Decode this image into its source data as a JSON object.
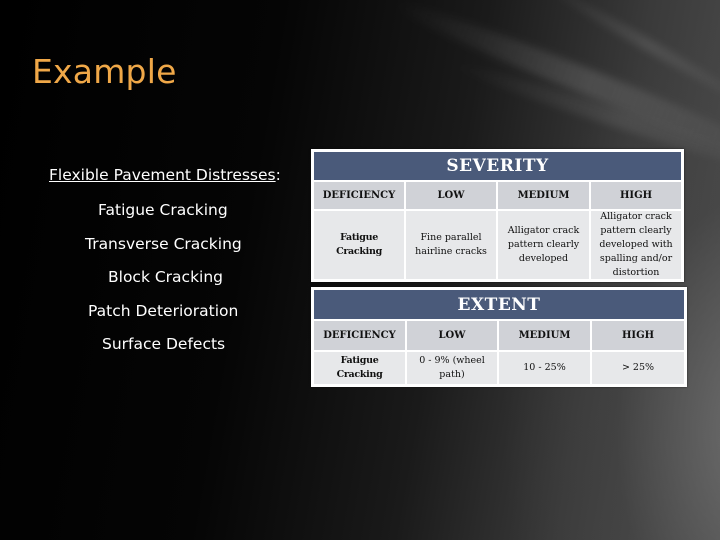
{
  "slide": {
    "title": "Example",
    "colors": {
      "title": "#f0a848",
      "table_caption_bg": "#4a5a7a",
      "table_header_bg": "#d0d2d7",
      "table_cell_bg": "#e7e8ea"
    }
  },
  "distresses": {
    "heading": "Flexible Pavement Distresses",
    "heading_suffix": ":",
    "items": [
      "Fatigue Cracking",
      "Transverse Cracking",
      "Block Cracking",
      "Patch Deterioration",
      "Surface Defects"
    ]
  },
  "severity_table": {
    "caption": "SEVERITY",
    "headers": [
      "DEFICIENCY",
      "LOW",
      "MEDIUM",
      "HIGH"
    ],
    "rows": [
      [
        "Fatigue Cracking",
        "Fine parallel hairline cracks",
        "Alligator crack pattern clearly developed",
        "Alligator crack pattern clearly developed with spalling and/or distortion"
      ]
    ]
  },
  "extent_table": {
    "caption": "EXTENT",
    "headers": [
      "DEFICIENCY",
      "LOW",
      "MEDIUM",
      "HIGH"
    ],
    "rows": [
      [
        "Fatigue Cracking",
        "0 - 9% (wheel path)",
        "10 - 25%",
        "> 25%"
      ]
    ]
  }
}
